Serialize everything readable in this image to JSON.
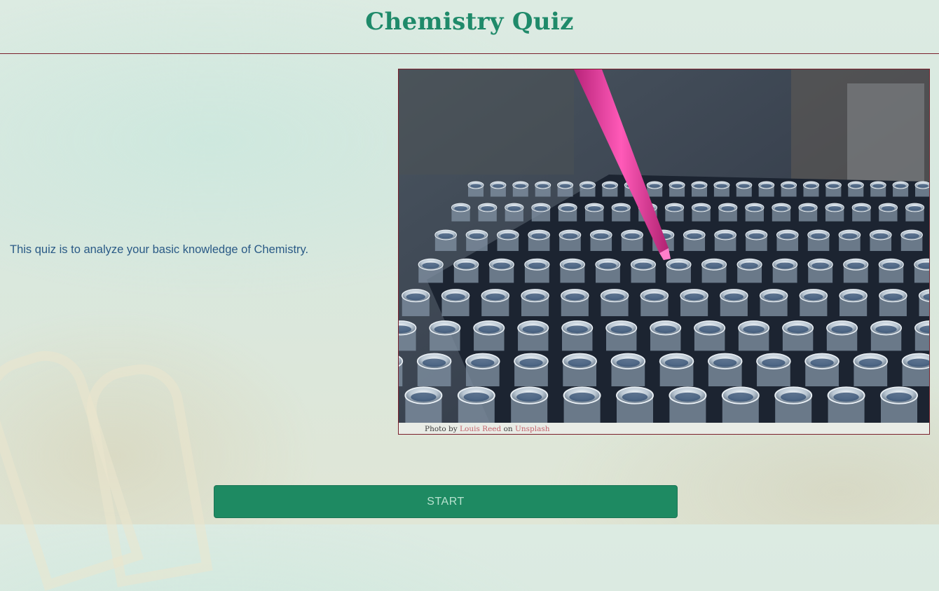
{
  "header": {
    "title": "Chemistry Quiz"
  },
  "intro": {
    "text": "This quiz is to analyze your basic knowledge of Chemistry."
  },
  "photo": {
    "subject": "pipette-over-test-tube-rack",
    "caption": {
      "prefix": "Photo by",
      "author": "Louis Reed",
      "middle": "on",
      "site": "Unsplash"
    }
  },
  "start": {
    "label": "START"
  },
  "colors": {
    "title": "#1f8a6a",
    "intro_text": "#2a5a86",
    "divider": "#7a1f2b",
    "button_bg": "#1e8a62",
    "button_text": "#b7e2cf",
    "caption_link": "#c4636c",
    "pipette": "#e0399a"
  }
}
